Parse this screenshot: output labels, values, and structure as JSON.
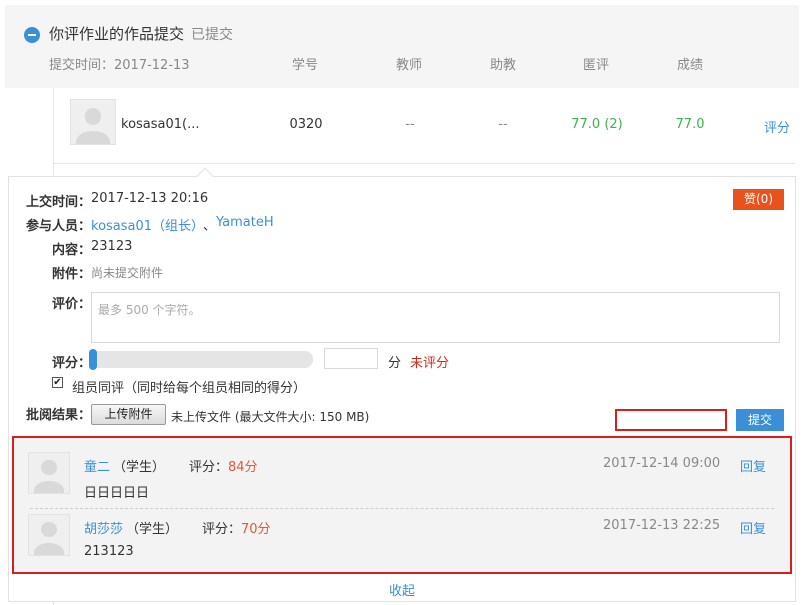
{
  "header": {
    "title": "你评作业的作品提交",
    "status": "已提交",
    "submit_time": "提交时间：2017-12-13",
    "columns": [
      "学号",
      "教师",
      "助教",
      "匿评",
      "成绩"
    ]
  },
  "row": {
    "name": "kosasa01(...",
    "student_id": "0320",
    "teacher": "--",
    "assistant": "--",
    "anon_score": "77.0 (2)",
    "score": "77.0",
    "action": "评分"
  },
  "detail": {
    "upload_time_label": "上交时间：",
    "upload_time": "2017-12-13 20:16",
    "like_label": "赞(0)",
    "members_label": "参与人员：",
    "member1": "kosasa01（组长）",
    "member_sep": "、",
    "member2": "YamateH",
    "content_label": "内容：",
    "content": "23123",
    "attachment_label": "附件：",
    "attachment": "尚未提交附件",
    "comment_label": "评价：",
    "comment_placeholder": "最多 500 个字符。",
    "score_label": "评分：",
    "score_unit": "分",
    "score_status": "未评分",
    "slider_value": 0,
    "group_same_label": "组员同评（同时给每个组员相同的得分）",
    "group_same_checked": true,
    "review_result_label": "批阅结果：",
    "upload_button": "上传附件",
    "upload_info": "未上传文件 (最大文件大小: 150 MB)",
    "submit_button": "提交",
    "collapse_label": "收起"
  },
  "reviews": [
    {
      "name": "童二",
      "role": "（学生）",
      "score_label": "评分：",
      "score": "84分",
      "time": "2017-12-14 09:00",
      "reply": "回复",
      "content": "日日日日日"
    },
    {
      "name": "胡莎莎",
      "role": "（学生）",
      "score_label": "评分：",
      "score": "70分",
      "time": "2017-12-13 22:25",
      "reply": "回复",
      "content": "213123"
    }
  ],
  "colors": {
    "accent": "#3b8fd8",
    "like": "#e8531d",
    "highlight_border": "#d81e1e",
    "score_green": "#39b54a",
    "status_red": "#d9281a"
  }
}
